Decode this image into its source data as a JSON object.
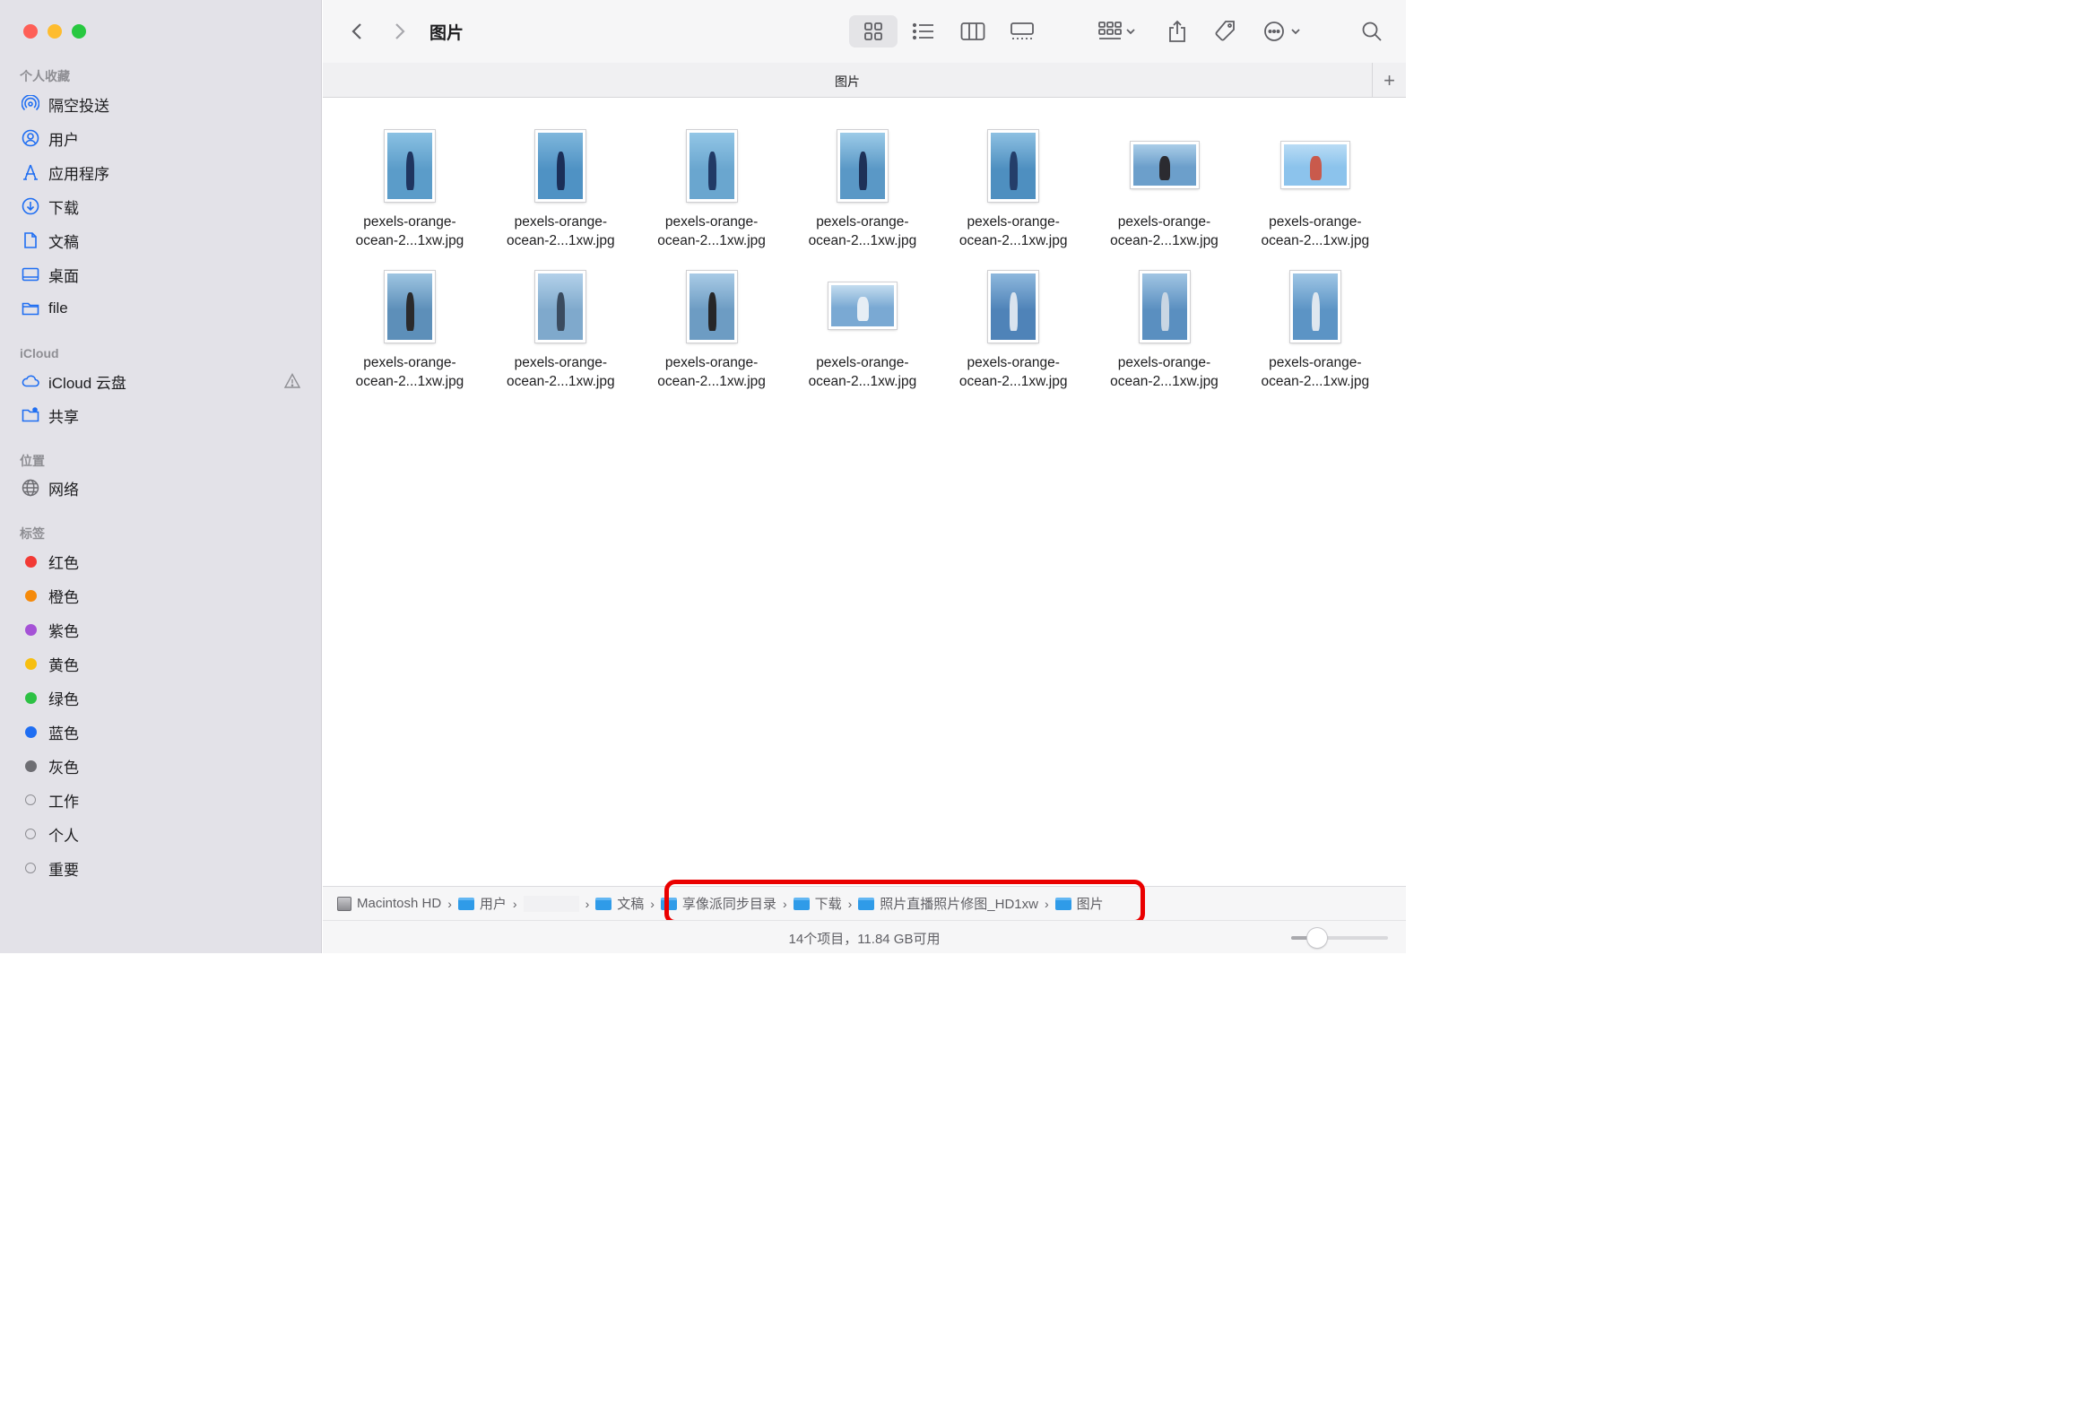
{
  "window": {
    "title": "图片",
    "tab_label": "图片",
    "tab_add": "+",
    "traffic_colors": [
      "#fe5f57",
      "#febc2e",
      "#28c840"
    ]
  },
  "sidebar": {
    "sections": [
      {
        "title": "个人收藏",
        "items": [
          {
            "label": "隔空投送",
            "icon": "airdrop-icon"
          },
          {
            "label": "用户",
            "icon": "user-icon"
          },
          {
            "label": "应用程序",
            "icon": "applications-icon"
          },
          {
            "label": "下载",
            "icon": "download-icon"
          },
          {
            "label": "文稿",
            "icon": "document-icon"
          },
          {
            "label": "桌面",
            "icon": "desktop-icon"
          },
          {
            "label": "file",
            "icon": "folder-icon"
          }
        ]
      },
      {
        "title": "iCloud",
        "items": [
          {
            "label": "iCloud 云盘",
            "icon": "cloud-icon"
          },
          {
            "label": "共享",
            "icon": "shared-folder-icon"
          }
        ]
      },
      {
        "title": "位置",
        "items": [
          {
            "label": "网络",
            "icon": "network-icon"
          }
        ]
      },
      {
        "title": "标签",
        "items": [
          {
            "label": "红色",
            "color": "#f23a35"
          },
          {
            "label": "橙色",
            "color": "#f58a0b"
          },
          {
            "label": "紫色",
            "color": "#a552d6"
          },
          {
            "label": "黄色",
            "color": "#f7bf10"
          },
          {
            "label": "绿色",
            "color": "#2dc144"
          },
          {
            "label": "蓝色",
            "color": "#1f6ef2"
          },
          {
            "label": "灰色",
            "color": "#6e6e73"
          },
          {
            "label": "工作",
            "color": ""
          },
          {
            "label": "个人",
            "color": ""
          },
          {
            "label": "重要",
            "color": ""
          }
        ]
      }
    ]
  },
  "files": [
    {
      "line1": "pexels-orange-",
      "line2": "ocean-2...1xw.jpg",
      "orientation": "portrait",
      "palette": [
        "#5b9cc9",
        "#8ac1e3",
        "#1f3560"
      ]
    },
    {
      "line1": "pexels-orange-",
      "line2": "ocean-2...1xw.jpg",
      "orientation": "portrait",
      "palette": [
        "#4f92c4",
        "#7fb7dc",
        "#1b2f58"
      ]
    },
    {
      "line1": "pexels-orange-",
      "line2": "ocean-2...1xw.jpg",
      "orientation": "portrait",
      "palette": [
        "#6aa6cf",
        "#93c6e6",
        "#213a66"
      ]
    },
    {
      "line1": "pexels-orange-",
      "line2": "ocean-2...1xw.jpg",
      "orientation": "portrait",
      "palette": [
        "#5a98c6",
        "#9ccbe8",
        "#1e3158"
      ]
    },
    {
      "line1": "pexels-orange-",
      "line2": "ocean-2...1xw.jpg",
      "orientation": "portrait",
      "palette": [
        "#4e8fc0",
        "#8dc0e2",
        "#243e6a"
      ]
    },
    {
      "line1": "pexels-orange-",
      "line2": "ocean-2...1xw.jpg",
      "orientation": "landscape",
      "palette": [
        "#6c9fcb",
        "#aacde8",
        "#2b2b30"
      ]
    },
    {
      "line1": "pexels-orange-",
      "line2": "ocean-2...1xw.jpg",
      "orientation": "landscape",
      "palette": [
        "#8cc3ec",
        "#b9dcf5",
        "#c95a4c"
      ]
    },
    {
      "line1": "pexels-orange-",
      "line2": "ocean-2...1xw.jpg",
      "orientation": "portrait",
      "palette": [
        "#5d8fb9",
        "#9ec5e2",
        "#2a2a2c"
      ]
    },
    {
      "line1": "pexels-orange-",
      "line2": "ocean-2...1xw.jpg",
      "orientation": "portrait",
      "palette": [
        "#7fa9cc",
        "#b3d1ea",
        "#3a4b5f"
      ]
    },
    {
      "line1": "pexels-orange-",
      "line2": "ocean-2...1xw.jpg",
      "orientation": "portrait",
      "palette": [
        "#6d9cc3",
        "#a9cbe6",
        "#262628"
      ]
    },
    {
      "line1": "pexels-orange-",
      "line2": "ocean-2...1xw.jpg",
      "orientation": "landscape",
      "palette": [
        "#7aa9d3",
        "#c3dcef",
        "#e6eef5"
      ]
    },
    {
      "line1": "pexels-orange-",
      "line2": "ocean-2...1xw.jpg",
      "orientation": "portrait",
      "palette": [
        "#4f83b8",
        "#8eb8dd",
        "#d9e3ee"
      ]
    },
    {
      "line1": "pexels-orange-",
      "line2": "ocean-2...1xw.jpg",
      "orientation": "portrait",
      "palette": [
        "#5a8fc0",
        "#a1c5e3",
        "#c9d6e3"
      ]
    },
    {
      "line1": "pexels-orange-",
      "line2": "ocean-2...1xw.jpg",
      "orientation": "portrait",
      "palette": [
        "#5c94c5",
        "#9fc6e5",
        "#dfe7ef"
      ]
    }
  ],
  "pathbar": {
    "crumbs": [
      {
        "label": "Macintosh HD",
        "icon": "hard-drive-icon"
      },
      {
        "label": "用户",
        "icon": "folder-icon"
      },
      {
        "label": "",
        "icon": ""
      },
      {
        "label": "文稿",
        "icon": "folder-icon"
      },
      {
        "label": "享像派同步目录",
        "icon": "folder-icon"
      },
      {
        "label": "下载",
        "icon": "folder-icon"
      },
      {
        "label": "照片直播照片修图_HD1xw",
        "icon": "folder-icon"
      },
      {
        "label": "图片",
        "icon": "folder-icon"
      }
    ]
  },
  "status": {
    "text": "14个项目，11.84 GB可用",
    "icon_size_level": 0.27
  },
  "highlight_color": "#ea0000"
}
